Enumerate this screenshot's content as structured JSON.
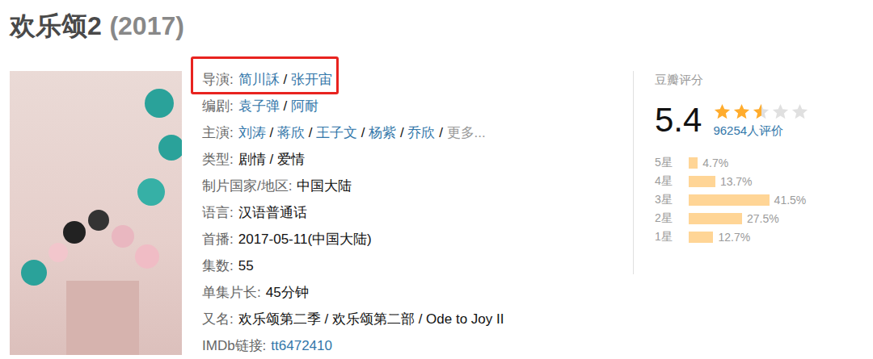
{
  "title": "欢乐颂2",
  "year": "(2017)",
  "separator": " / ",
  "info": [
    {
      "label": "导演:",
      "highlighted": true,
      "values": [
        {
          "text": "简川訸",
          "kind": "link"
        },
        {
          "text": "张开宙",
          "kind": "link"
        }
      ]
    },
    {
      "label": "编剧:",
      "highlighted": false,
      "values": [
        {
          "text": "袁子弹",
          "kind": "link"
        },
        {
          "text": "阿耐",
          "kind": "link"
        }
      ]
    },
    {
      "label": "主演:",
      "highlighted": false,
      "values": [
        {
          "text": "刘涛",
          "kind": "link"
        },
        {
          "text": "蒋欣",
          "kind": "link"
        },
        {
          "text": "王子文",
          "kind": "link"
        },
        {
          "text": "杨紫",
          "kind": "link"
        },
        {
          "text": "乔欣",
          "kind": "link"
        },
        {
          "text": "更多...",
          "kind": "more"
        }
      ]
    },
    {
      "label": "类型:",
      "highlighted": false,
      "values": [
        {
          "text": "剧情",
          "kind": "plain"
        },
        {
          "text": "爱情",
          "kind": "plain"
        }
      ]
    },
    {
      "label": "制片国家/地区:",
      "highlighted": false,
      "values": [
        {
          "text": "中国大陆",
          "kind": "plain"
        }
      ]
    },
    {
      "label": "语言:",
      "highlighted": false,
      "values": [
        {
          "text": "汉语普通话",
          "kind": "plain"
        }
      ]
    },
    {
      "label": "首播:",
      "highlighted": false,
      "values": [
        {
          "text": "2017-05-11(中国大陆)",
          "kind": "plain"
        }
      ]
    },
    {
      "label": "集数:",
      "highlighted": false,
      "values": [
        {
          "text": "55",
          "kind": "plain"
        }
      ]
    },
    {
      "label": "单集片长:",
      "highlighted": false,
      "values": [
        {
          "text": "45分钟",
          "kind": "plain"
        }
      ]
    },
    {
      "label": "又名:",
      "highlighted": false,
      "values": [
        {
          "text": "欢乐颂第二季",
          "kind": "plain"
        },
        {
          "text": "欢乐颂第二部",
          "kind": "plain"
        },
        {
          "text": "Ode to Joy II",
          "kind": "plain"
        }
      ]
    },
    {
      "label": "IMDb链接:",
      "highlighted": false,
      "values": [
        {
          "text": "tt6472410",
          "kind": "link"
        }
      ]
    }
  ],
  "rating": {
    "label": "豆瓣评分",
    "score": "5.4",
    "stars": 2.5,
    "votes": "96254人评价",
    "distribution": [
      {
        "label": "5星",
        "reading": "4.7%",
        "level": 0.047
      },
      {
        "label": "4星",
        "reading": "13.7%",
        "level": 0.137
      },
      {
        "label": "3星",
        "reading": "41.5%",
        "level": 0.415
      },
      {
        "label": "2星",
        "reading": "27.5%",
        "level": 0.275
      },
      {
        "label": "1星",
        "reading": "12.7%",
        "level": 0.127
      }
    ]
  }
}
